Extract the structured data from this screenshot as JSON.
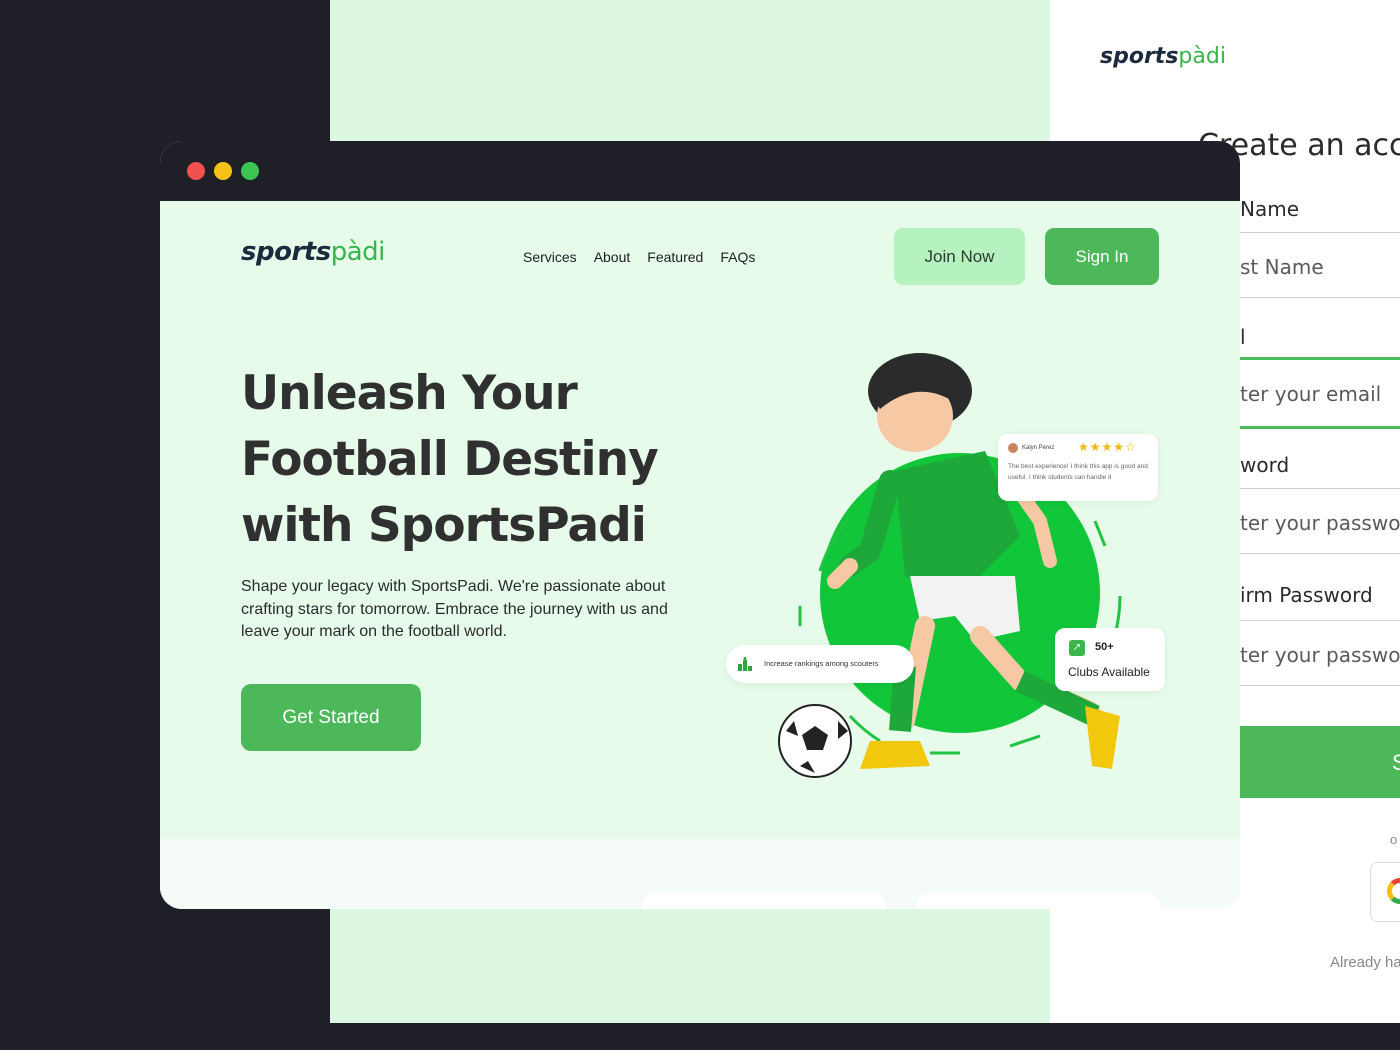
{
  "colors": {
    "brand_green": "#4cb85a",
    "light_green": "#b6f2c0",
    "bg_mint": "#e6fbea",
    "dark": "#1f2027"
  },
  "brand": {
    "logo_part1": "sports",
    "logo_part2": "pàdi"
  },
  "nav": {
    "items": [
      "Services",
      "About",
      "Featured",
      "FAQs"
    ]
  },
  "buttons": {
    "join": "Join Now",
    "signin": "Sign In",
    "get_started": "Get Started"
  },
  "hero": {
    "title": "Unleash Your Football Destiny with SportsPadi",
    "subtitle": "Shape your legacy with SportsPadi. We're passionate about crafting stars for tomorrow. Embrace the journey with us and leave your mark on the football world."
  },
  "cards": {
    "review_name": "Kalyn Perez",
    "review_stars": "★★★★☆",
    "review_text": "The best experience! I think this app is good and useful. I think students can handle it",
    "rank_text": "Increase rankings among scouters",
    "clubs_count": "50+",
    "clubs_label": "Clubs Available"
  },
  "signup": {
    "title": "Create an acco",
    "first_name_label": "Name",
    "first_name_placeholder": "st Name",
    "email_label": "l",
    "email_placeholder": "ter your email",
    "password_label": "word",
    "password_placeholder": "ter your passwor",
    "confirm_label": "irm Password",
    "confirm_placeholder": "ter your passwor",
    "submit": "S",
    "or": "o",
    "already": "Already ha"
  }
}
